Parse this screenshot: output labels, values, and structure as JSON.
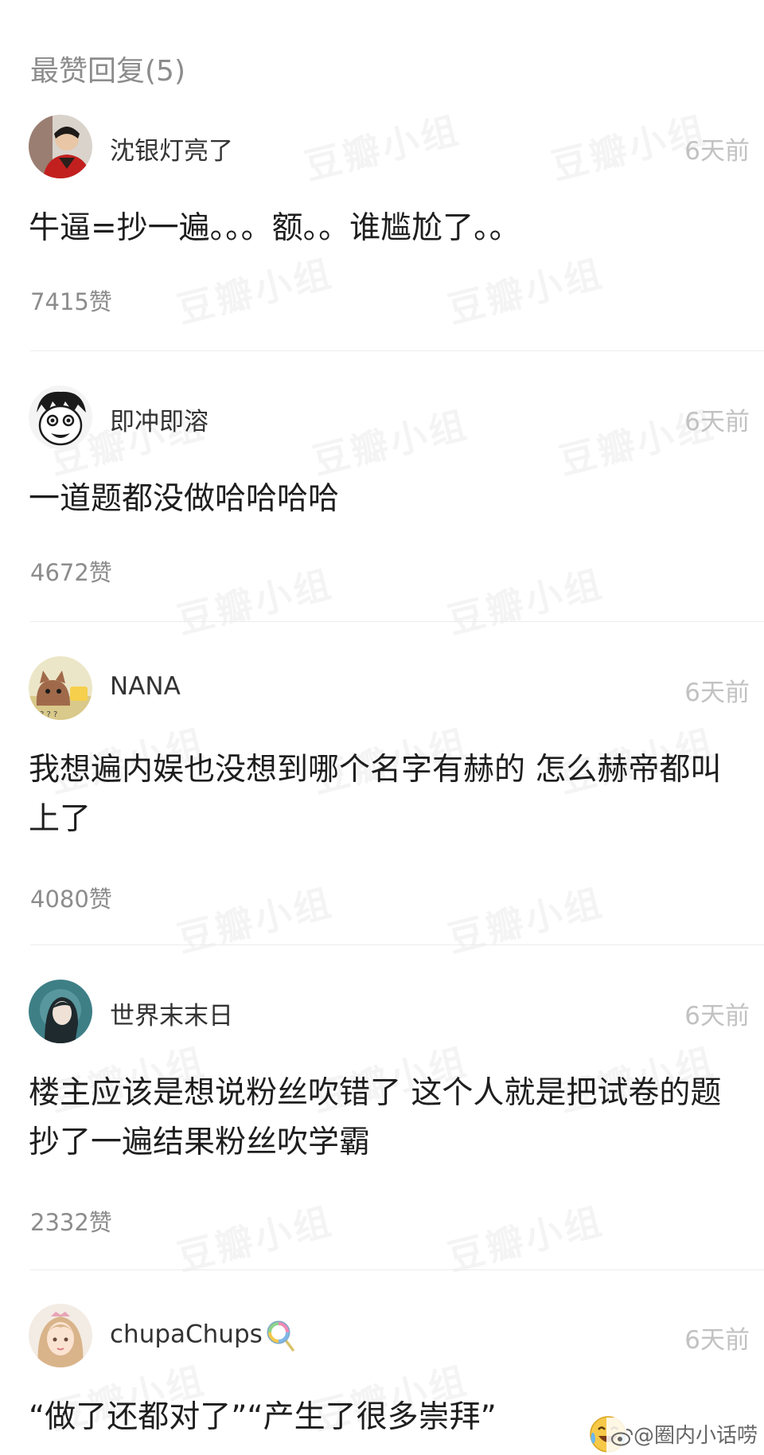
{
  "section": {
    "title": "最赞回复(5)"
  },
  "watermark_text": "豆瓣小组",
  "comments": [
    {
      "username": "沈银灯亮了",
      "time": "6天前",
      "content": "牛逼=抄一遍。。。额。。谁尴尬了。。",
      "likes": "7415赞",
      "avatar_icon": "avatar-woman-red"
    },
    {
      "username": "即冲即溶",
      "time": "6天前",
      "content": "一道题都没做哈哈哈哈",
      "likes": "4672赞",
      "avatar_icon": "avatar-cartoon-face"
    },
    {
      "username": "NANA",
      "time": "6天前",
      "content": "我想遍内娱也没想到哪个名字有赫的 怎么赫帝都叫上了",
      "likes": "4080赞",
      "avatar_icon": "avatar-cartoon-cat"
    },
    {
      "username": "世界末末日",
      "time": "6天前",
      "content": "楼主应该是想说粉丝吹错了 这个人就是把试卷的题抄了一遍结果粉丝吹学霸",
      "likes": "2332赞",
      "avatar_icon": "avatar-girl-teal"
    },
    {
      "username": "chupaChups",
      "username_emoji": "lollipop-icon",
      "time": "6天前",
      "content": "“做了还都对了”“产生了很多崇拜”",
      "content_emoji": "laughing-tears-emoji",
      "likes": "",
      "avatar_icon": "avatar-anime-girl"
    }
  ],
  "credit": {
    "text": "@圈内小话唠"
  },
  "colors": {
    "text": "#1e1e1e",
    "muted": "#8c8c8c",
    "time": "#c2c2c2",
    "divider": "#ececec"
  }
}
